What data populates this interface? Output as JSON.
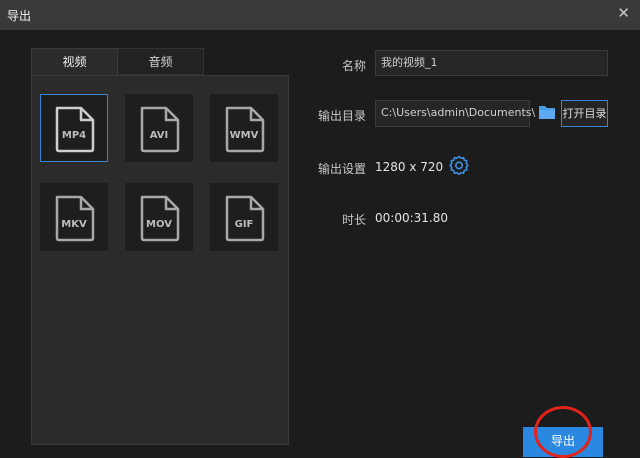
{
  "window": {
    "title": "导出",
    "close_icon": "close-icon"
  },
  "tabs": [
    {
      "label": "视频",
      "active": true
    },
    {
      "label": "音频",
      "active": false
    }
  ],
  "formats": [
    {
      "label": "MP4",
      "selected": true
    },
    {
      "label": "AVI",
      "selected": false
    },
    {
      "label": "WMV",
      "selected": false
    },
    {
      "label": "MKV",
      "selected": false
    },
    {
      "label": "MOV",
      "selected": false
    },
    {
      "label": "GIF",
      "selected": false
    }
  ],
  "settings": {
    "name_label": "名称",
    "name_value": "我的视频_1",
    "dir_label": "输出目录",
    "dir_value": "C:\\Users\\admin\\Documents\\",
    "open_dir_label": "打开目录",
    "output_settings_label": "输出设置",
    "resolution": "1280 x 720",
    "duration_label": "时长",
    "duration_value": "00:00:31.80"
  },
  "export_button": {
    "label": "导出"
  },
  "colors": {
    "accent": "#2b88e0",
    "highlight_circle": "#e2231a",
    "folder": "#4a9be0"
  }
}
